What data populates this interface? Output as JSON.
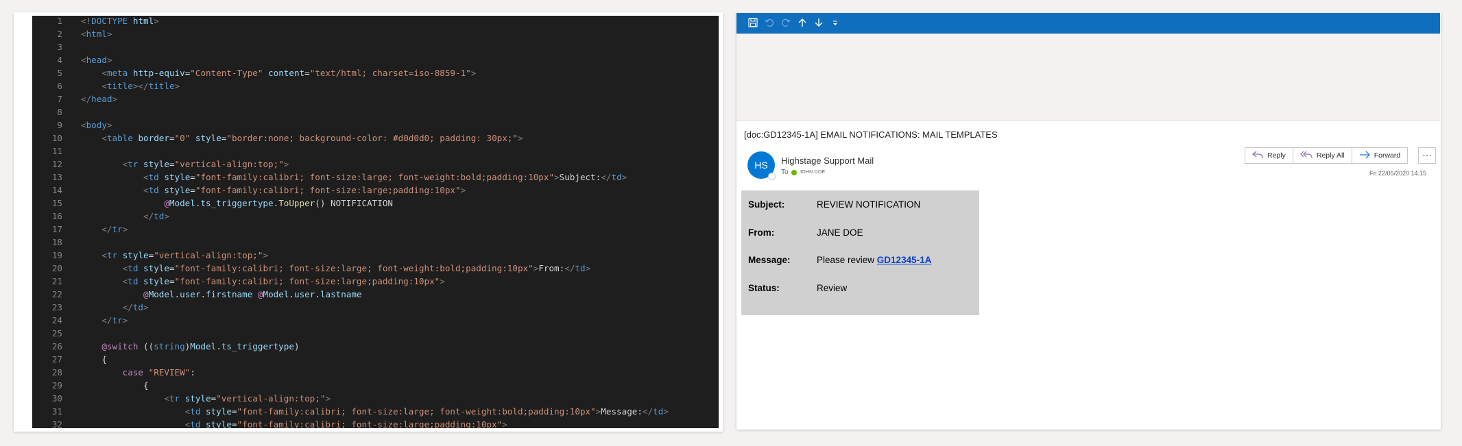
{
  "code": {
    "lines": [
      {
        "n": "1",
        "tokens": [
          {
            "c": "t-tag",
            "t": "<!"
          },
          {
            "c": "t-doctype",
            "t": "DOCTYPE"
          },
          {
            "c": "t-text",
            "t": " "
          },
          {
            "c": "t-attr",
            "t": "html"
          },
          {
            "c": "t-tag",
            "t": ">"
          }
        ]
      },
      {
        "n": "2",
        "tokens": [
          {
            "c": "t-tag",
            "t": "<"
          },
          {
            "c": "t-name",
            "t": "html"
          },
          {
            "c": "t-tag",
            "t": ">"
          }
        ]
      },
      {
        "n": "3",
        "tokens": []
      },
      {
        "n": "4",
        "tokens": [
          {
            "c": "t-tag",
            "t": "<"
          },
          {
            "c": "t-name",
            "t": "head"
          },
          {
            "c": "t-tag",
            "t": ">"
          }
        ]
      },
      {
        "n": "5",
        "tokens": [
          {
            "c": "t-text",
            "t": "    "
          },
          {
            "c": "t-tag",
            "t": "<"
          },
          {
            "c": "t-name",
            "t": "meta"
          },
          {
            "c": "t-text",
            "t": " "
          },
          {
            "c": "t-attr",
            "t": "http-equiv"
          },
          {
            "c": "t-text",
            "t": "="
          },
          {
            "c": "t-str",
            "t": "\"Content-Type\""
          },
          {
            "c": "t-text",
            "t": " "
          },
          {
            "c": "t-attr",
            "t": "content"
          },
          {
            "c": "t-text",
            "t": "="
          },
          {
            "c": "t-str",
            "t": "\"text/html; charset=iso-8859-1\""
          },
          {
            "c": "t-tag",
            "t": ">"
          }
        ]
      },
      {
        "n": "6",
        "tokens": [
          {
            "c": "t-text",
            "t": "    "
          },
          {
            "c": "t-tag",
            "t": "<"
          },
          {
            "c": "t-name",
            "t": "title"
          },
          {
            "c": "t-tag",
            "t": "></"
          },
          {
            "c": "t-name",
            "t": "title"
          },
          {
            "c": "t-tag",
            "t": ">"
          }
        ]
      },
      {
        "n": "7",
        "tokens": [
          {
            "c": "t-tag",
            "t": "</"
          },
          {
            "c": "t-name",
            "t": "head"
          },
          {
            "c": "t-tag",
            "t": ">"
          }
        ]
      },
      {
        "n": "8",
        "tokens": []
      },
      {
        "n": "9",
        "tokens": [
          {
            "c": "t-tag",
            "t": "<"
          },
          {
            "c": "t-name",
            "t": "body"
          },
          {
            "c": "t-tag",
            "t": ">"
          }
        ]
      },
      {
        "n": "10",
        "tokens": [
          {
            "c": "t-text",
            "t": "    "
          },
          {
            "c": "t-tag",
            "t": "<"
          },
          {
            "c": "t-name",
            "t": "table"
          },
          {
            "c": "t-text",
            "t": " "
          },
          {
            "c": "t-attr",
            "t": "border"
          },
          {
            "c": "t-text",
            "t": "="
          },
          {
            "c": "t-str",
            "t": "\"0\""
          },
          {
            "c": "t-text",
            "t": " "
          },
          {
            "c": "t-attr",
            "t": "style"
          },
          {
            "c": "t-text",
            "t": "="
          },
          {
            "c": "t-str",
            "t": "\"border:none; background-color: #d0d0d0; padding: 30px;\""
          },
          {
            "c": "t-tag",
            "t": ">"
          }
        ]
      },
      {
        "n": "11",
        "tokens": []
      },
      {
        "n": "12",
        "tokens": [
          {
            "c": "t-text",
            "t": "        "
          },
          {
            "c": "t-tag",
            "t": "<"
          },
          {
            "c": "t-name",
            "t": "tr"
          },
          {
            "c": "t-text",
            "t": " "
          },
          {
            "c": "t-attr",
            "t": "style"
          },
          {
            "c": "t-text",
            "t": "="
          },
          {
            "c": "t-str",
            "t": "\"vertical-align:top;\""
          },
          {
            "c": "t-tag",
            "t": ">"
          }
        ]
      },
      {
        "n": "13",
        "tokens": [
          {
            "c": "t-text",
            "t": "            "
          },
          {
            "c": "t-tag",
            "t": "<"
          },
          {
            "c": "t-name",
            "t": "td"
          },
          {
            "c": "t-text",
            "t": " "
          },
          {
            "c": "t-attr",
            "t": "style"
          },
          {
            "c": "t-text",
            "t": "="
          },
          {
            "c": "t-str",
            "t": "\"font-family:calibri; font-size:large; font-weight:bold;padding:10px\""
          },
          {
            "c": "t-tag",
            "t": ">"
          },
          {
            "c": "t-text",
            "t": "Subject:"
          },
          {
            "c": "t-tag",
            "t": "</"
          },
          {
            "c": "t-name",
            "t": "td"
          },
          {
            "c": "t-tag",
            "t": ">"
          }
        ]
      },
      {
        "n": "14",
        "tokens": [
          {
            "c": "t-text",
            "t": "            "
          },
          {
            "c": "t-tag",
            "t": "<"
          },
          {
            "c": "t-name",
            "t": "td"
          },
          {
            "c": "t-text",
            "t": " "
          },
          {
            "c": "t-attr",
            "t": "style"
          },
          {
            "c": "t-text",
            "t": "="
          },
          {
            "c": "t-str",
            "t": "\"font-family:calibri; font-size:large;padding:10px\""
          },
          {
            "c": "t-tag",
            "t": ">"
          }
        ]
      },
      {
        "n": "15",
        "tokens": [
          {
            "c": "t-text",
            "t": "                "
          },
          {
            "c": "t-razor",
            "t": "@"
          },
          {
            "c": "t-member",
            "t": "Model"
          },
          {
            "c": "t-text",
            "t": "."
          },
          {
            "c": "t-member",
            "t": "ts_triggertype"
          },
          {
            "c": "t-text",
            "t": "."
          },
          {
            "c": "t-method",
            "t": "ToUpper"
          },
          {
            "c": "t-text",
            "t": "() NOTIFICATION"
          }
        ]
      },
      {
        "n": "16",
        "tokens": [
          {
            "c": "t-text",
            "t": "            "
          },
          {
            "c": "t-tag",
            "t": "</"
          },
          {
            "c": "t-name",
            "t": "td"
          },
          {
            "c": "t-tag",
            "t": ">"
          }
        ]
      },
      {
        "n": "17",
        "tokens": [
          {
            "c": "t-text",
            "t": "    "
          },
          {
            "c": "t-tag",
            "t": "</"
          },
          {
            "c": "t-name",
            "t": "tr"
          },
          {
            "c": "t-tag",
            "t": ">"
          }
        ]
      },
      {
        "n": "18",
        "tokens": []
      },
      {
        "n": "19",
        "tokens": [
          {
            "c": "t-text",
            "t": "    "
          },
          {
            "c": "t-tag",
            "t": "<"
          },
          {
            "c": "t-name",
            "t": "tr"
          },
          {
            "c": "t-text",
            "t": " "
          },
          {
            "c": "t-attr",
            "t": "style"
          },
          {
            "c": "t-text",
            "t": "="
          },
          {
            "c": "t-str",
            "t": "\"vertical-align:top;\""
          },
          {
            "c": "t-tag",
            "t": ">"
          }
        ]
      },
      {
        "n": "20",
        "tokens": [
          {
            "c": "t-text",
            "t": "        "
          },
          {
            "c": "t-tag",
            "t": "<"
          },
          {
            "c": "t-name",
            "t": "td"
          },
          {
            "c": "t-text",
            "t": " "
          },
          {
            "c": "t-attr",
            "t": "style"
          },
          {
            "c": "t-text",
            "t": "="
          },
          {
            "c": "t-str",
            "t": "\"font-family:calibri; font-size:large; font-weight:bold;padding:10px\""
          },
          {
            "c": "t-tag",
            "t": ">"
          },
          {
            "c": "t-text",
            "t": "From:"
          },
          {
            "c": "t-tag",
            "t": "</"
          },
          {
            "c": "t-name",
            "t": "td"
          },
          {
            "c": "t-tag",
            "t": ">"
          }
        ]
      },
      {
        "n": "21",
        "tokens": [
          {
            "c": "t-text",
            "t": "        "
          },
          {
            "c": "t-tag",
            "t": "<"
          },
          {
            "c": "t-name",
            "t": "td"
          },
          {
            "c": "t-text",
            "t": " "
          },
          {
            "c": "t-attr",
            "t": "style"
          },
          {
            "c": "t-text",
            "t": "="
          },
          {
            "c": "t-str",
            "t": "\"font-family:calibri; font-size:large;padding:10px\""
          },
          {
            "c": "t-tag",
            "t": ">"
          }
        ]
      },
      {
        "n": "22",
        "tokens": [
          {
            "c": "t-text",
            "t": "            "
          },
          {
            "c": "t-razor",
            "t": "@"
          },
          {
            "c": "t-member",
            "t": "Model"
          },
          {
            "c": "t-text",
            "t": "."
          },
          {
            "c": "t-member",
            "t": "user"
          },
          {
            "c": "t-text",
            "t": "."
          },
          {
            "c": "t-member",
            "t": "firstname"
          },
          {
            "c": "t-text",
            "t": " "
          },
          {
            "c": "t-razor",
            "t": "@"
          },
          {
            "c": "t-member",
            "t": "Model"
          },
          {
            "c": "t-text",
            "t": "."
          },
          {
            "c": "t-member",
            "t": "user"
          },
          {
            "c": "t-text",
            "t": "."
          },
          {
            "c": "t-member",
            "t": "lastname"
          }
        ]
      },
      {
        "n": "23",
        "tokens": [
          {
            "c": "t-text",
            "t": "        "
          },
          {
            "c": "t-tag",
            "t": "</"
          },
          {
            "c": "t-name",
            "t": "td"
          },
          {
            "c": "t-tag",
            "t": ">"
          }
        ]
      },
      {
        "n": "24",
        "tokens": [
          {
            "c": "t-text",
            "t": "    "
          },
          {
            "c": "t-tag",
            "t": "</"
          },
          {
            "c": "t-name",
            "t": "tr"
          },
          {
            "c": "t-tag",
            "t": ">"
          }
        ]
      },
      {
        "n": "25",
        "tokens": []
      },
      {
        "n": "26",
        "tokens": [
          {
            "c": "t-text",
            "t": "    "
          },
          {
            "c": "t-razor",
            "t": "@switch"
          },
          {
            "c": "t-text",
            "t": " (("
          },
          {
            "c": "t-kw",
            "t": "string"
          },
          {
            "c": "t-text",
            "t": ")"
          },
          {
            "c": "t-member",
            "t": "Model"
          },
          {
            "c": "t-text",
            "t": "."
          },
          {
            "c": "t-member",
            "t": "ts_triggertype"
          },
          {
            "c": "t-text",
            "t": ")"
          }
        ]
      },
      {
        "n": "27",
        "tokens": [
          {
            "c": "t-text",
            "t": "    {"
          }
        ]
      },
      {
        "n": "28",
        "tokens": [
          {
            "c": "t-text",
            "t": "        "
          },
          {
            "c": "t-razor",
            "t": "case"
          },
          {
            "c": "t-text",
            "t": " "
          },
          {
            "c": "t-str",
            "t": "\"REVIEW\""
          },
          {
            "c": "t-text",
            "t": ":"
          }
        ]
      },
      {
        "n": "29",
        "tokens": [
          {
            "c": "t-text",
            "t": "            {"
          }
        ]
      },
      {
        "n": "30",
        "tokens": [
          {
            "c": "t-text",
            "t": "                "
          },
          {
            "c": "t-tag",
            "t": "<"
          },
          {
            "c": "t-name",
            "t": "tr"
          },
          {
            "c": "t-text",
            "t": " "
          },
          {
            "c": "t-attr",
            "t": "style"
          },
          {
            "c": "t-text",
            "t": "="
          },
          {
            "c": "t-str",
            "t": "\"vertical-align:top;\""
          },
          {
            "c": "t-tag",
            "t": ">"
          }
        ]
      },
      {
        "n": "31",
        "tokens": [
          {
            "c": "t-text",
            "t": "                    "
          },
          {
            "c": "t-tag",
            "t": "<"
          },
          {
            "c": "t-name",
            "t": "td"
          },
          {
            "c": "t-text",
            "t": " "
          },
          {
            "c": "t-attr",
            "t": "style"
          },
          {
            "c": "t-text",
            "t": "="
          },
          {
            "c": "t-str",
            "t": "\"font-family:calibri; font-size:large; font-weight:bold;padding:10px\""
          },
          {
            "c": "t-tag",
            "t": ">"
          },
          {
            "c": "t-text",
            "t": "Message:"
          },
          {
            "c": "t-tag",
            "t": "</"
          },
          {
            "c": "t-name",
            "t": "td"
          },
          {
            "c": "t-tag",
            "t": ">"
          }
        ]
      },
      {
        "n": "32",
        "tokens": [
          {
            "c": "t-text",
            "t": "                    "
          },
          {
            "c": "t-tag",
            "t": "<"
          },
          {
            "c": "t-name",
            "t": "td"
          },
          {
            "c": "t-text",
            "t": " "
          },
          {
            "c": "t-attr",
            "t": "style"
          },
          {
            "c": "t-text",
            "t": "="
          },
          {
            "c": "t-str",
            "t": "\"font-family:calibri; font-size:large;padding:10px\""
          },
          {
            "c": "t-tag",
            "t": ">"
          }
        ]
      }
    ]
  },
  "quick_access": {
    "icons": [
      "save-icon",
      "undo-icon",
      "redo-icon",
      "up-arrow-icon",
      "down-arrow-icon",
      "customize-dropdown-icon"
    ],
    "accent_color": "#106ebe"
  },
  "mail": {
    "subject": "[doc:GD12345-1A] EMAIL NOTIFICATIONS: MAIL TEMPLATES",
    "avatar_initials": "HS",
    "avatar_color": "#0078d4",
    "sender": "Highstage Support Mail",
    "to_label": "To",
    "recipient": "JOHN DOE",
    "date": "Fri 22/05/2020 14.15",
    "actions": {
      "reply": "Reply",
      "reply_all": "Reply All",
      "forward": "Forward",
      "more": "···"
    },
    "body": {
      "background": "#d0d0d0",
      "subject_label": "Subject:",
      "subject_value": "REVIEW NOTIFICATION",
      "from_label": "From:",
      "from_value": "JANE DOE",
      "message_label": "Message:",
      "message_prefix": "Please review ",
      "message_link": "GD12345-1A",
      "status_label": "Status:",
      "status_value": "Review"
    }
  }
}
